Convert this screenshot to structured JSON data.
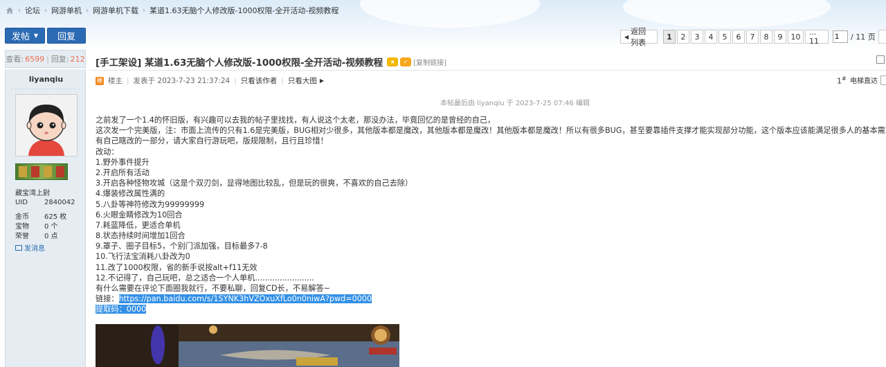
{
  "breadcrumb": [
    "论坛",
    "网游单机",
    "网游单机下载",
    "某道1.63无脑个人修改版-1000权限-全开活动-视频教程"
  ],
  "toolbar": {
    "post_label": "发帖",
    "reply_label": "回复"
  },
  "pager": {
    "back_label": "返回列表",
    "pages": [
      "1",
      "2",
      "3",
      "4",
      "5",
      "6",
      "7",
      "8",
      "9",
      "10",
      "... 11"
    ],
    "current": "1",
    "input_value": "1",
    "total_label": "/ 11 页"
  },
  "stats": {
    "views_label": "查看:",
    "views": "6599",
    "sep": "|",
    "replies_label": "回复:",
    "replies": "212"
  },
  "user": {
    "name": "liyanqiu",
    "rank": "藏宝湾上尉",
    "uid_label": "UID",
    "uid": "2840042",
    "gold_label": "金币",
    "gold": "625 枚",
    "treasure_label": "宝物",
    "treasure": "0 个",
    "honor_label": "荣誉",
    "honor": "0 点",
    "message_label": "发消息"
  },
  "post": {
    "title": "[手工架设] 某道1.63无脑个人修改版-1000权限-全开活动-视频教程",
    "copy_link": "[复制链接]",
    "op_label": "楼主",
    "posted_at": "发表于 2023-7-23 21:37:24",
    "author_only": "只看该作者",
    "big_image": "只看大图",
    "floor": "1",
    "floor_suffix": "#",
    "jump_label": "电梯直达",
    "edited": "本帖最后由 liyanqiu 于 2023-7-25 07:46 编辑",
    "lines": [
      "之前发了一个1.4的怀旧版，有兴趣可以去我的帖子里找找，有人说这个太老，那没办法，毕竟回忆的是曾经的自己，",
      "这次发一个完美版，注：市面上流传的只有1.6是完美版，BUG相对少很多，其他版本都是魔改，其他版本都是魔改！其他版本都是魔改！所以有很多BUG，甚至要靠插件支撑才能实现部分功能，这个版本应该能满足很多人的基本需求了。。。",
      "有自己瞎改的一部分，请大家自行游玩吧，版规限制，且行且珍惜！",
      "改动：",
      "1.野外事件提升",
      "2.开启所有活动",
      "3.开启各种怪物攻城（这是个双刃剑，显得地图比较乱，但是玩的很爽，不喜欢的自己去除）",
      "4.爆装修改属性满的",
      "5.八卦等神符修改为99999999",
      "6.火眼金睛修改为10回合",
      "7.耗蓝降低，更适合单机",
      "8.状态持续时间增加1回合",
      "9.罩子、圈子目标5，个别门派加强，目标最多7-8",
      "10.飞行法宝消耗八卦改为0",
      "11.改了1000权限，省的新手说按alt+f11无效",
      "12.不记得了，自己玩吧，总之适合一个人单机........................",
      "有什么需要在评论下面圈我就行，不要私聊，回复CD长，不易解答~"
    ],
    "link_label": "链接：",
    "link_url": "https://pan.baidu.com/s/1SYNK3hVZOxuXfLo0n0niwA?pwd=0000",
    "code_line": "提取码：0000"
  },
  "colors": {
    "accent": "#2b6bb3",
    "highlight": "#3390e6",
    "stat_number": "#f26c4f",
    "sidebar": "#e5edf2"
  }
}
